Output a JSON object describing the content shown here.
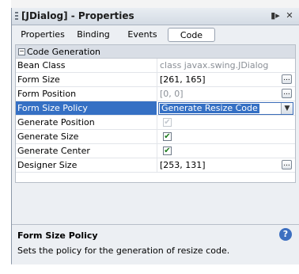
{
  "window": {
    "title": "[JDialog] - Properties"
  },
  "toolbar_icons": [
    "window-toggle-icon",
    "close-icon"
  ],
  "tabs": [
    {
      "label": "Properties",
      "active": false
    },
    {
      "label": "Binding",
      "active": false
    },
    {
      "label": "Events",
      "active": false
    },
    {
      "label": "Code",
      "active": true
    }
  ],
  "category": {
    "toggle": "−",
    "label": "Code Generation"
  },
  "properties": [
    {
      "name": "Bean Class",
      "value": "class javax.swing.JDialog",
      "value_style": "gray"
    },
    {
      "name": "Form Size",
      "value": "[261, 165]",
      "has_editor_button": true
    },
    {
      "name": "Form Position",
      "value": "[0, 0]",
      "value_style": "gray",
      "has_editor_button": true
    },
    {
      "name": "Form Size Policy",
      "value": "Generate Resize Code",
      "selected": true,
      "editor": "combo"
    },
    {
      "name": "Generate Position",
      "checked": true,
      "disabled": true
    },
    {
      "name": "Generate Size",
      "checked": true
    },
    {
      "name": "Generate Center",
      "checked": true
    },
    {
      "name": "Designer Size",
      "value": "[253, 131]",
      "has_editor_button": true
    }
  ],
  "editor_button_label": "...",
  "combo_arrow": "▼",
  "help": {
    "title": "Form Size Policy",
    "description": "Sets the policy for the generation of resize code.",
    "icon_label": "?"
  },
  "colors": {
    "selection": "#3570c4",
    "check": "#1a7a1a",
    "panel_bg": "#eceff3"
  }
}
